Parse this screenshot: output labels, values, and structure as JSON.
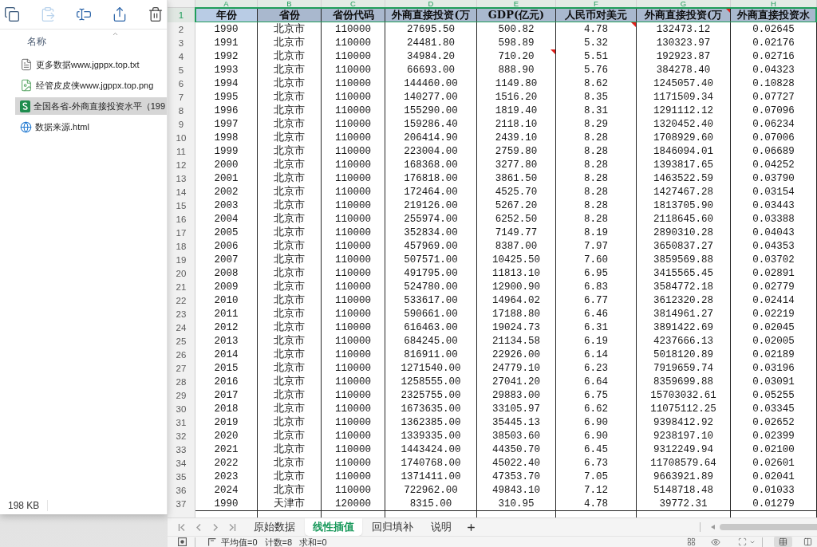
{
  "explorer": {
    "toolbar": [
      {
        "kind": "copy",
        "disabled": false
      },
      {
        "kind": "paste",
        "disabled": true
      },
      {
        "kind": "rename",
        "disabled": false
      },
      {
        "kind": "share",
        "disabled": false
      },
      {
        "kind": "delete",
        "disabled": false
      }
    ],
    "sort_ascending": true,
    "column_header": "名称",
    "files": [
      {
        "name": "更多数据www.jgppx.top.txt",
        "kind": "text",
        "selected": false
      },
      {
        "name": "经管皮皮侠www.jgppx.top.png",
        "kind": "image",
        "selected": false
      },
      {
        "name": "全国各省-外商直接投资水平（199",
        "kind": "spreadsheet",
        "selected": true
      },
      {
        "name": "数据来源.html",
        "kind": "web",
        "selected": false
      }
    ],
    "status": "198 KB"
  },
  "sheet": {
    "columns": [
      {
        "letter": "A",
        "highlighted": true
      },
      {
        "letter": "B",
        "highlighted": true
      },
      {
        "letter": "C",
        "highlighted": true
      },
      {
        "letter": "D",
        "highlighted": true
      },
      {
        "letter": "E",
        "highlighted": true
      },
      {
        "letter": "F",
        "highlighted": true
      },
      {
        "letter": "G",
        "highlighted": true
      },
      {
        "letter": "H",
        "highlighted": true
      }
    ],
    "rows": [
      {
        "kind": "header",
        "number": "1",
        "selected": true,
        "cells": [
          "年份",
          "省份",
          "省份代码",
          "外商直接投资(万",
          "GDP(亿元)",
          "人民币对美元",
          "外商直接投资(万",
          "外商直接投资水"
        ],
        "notes": [
          false,
          false,
          false,
          false,
          false,
          false,
          true,
          false
        ]
      },
      {
        "kind": "data",
        "number": "2",
        "selected": false,
        "cells": [
          "1990",
          "北京市",
          "110000",
          "27695.50",
          "500.82",
          "4.78",
          "132473.12",
          "0.02645"
        ],
        "notes": [
          false,
          false,
          false,
          false,
          false,
          true,
          false,
          false
        ]
      },
      {
        "kind": "data",
        "number": "3",
        "selected": false,
        "cells": [
          "1991",
          "北京市",
          "110000",
          "24481.80",
          "598.89",
          "5.32",
          "130323.97",
          "0.02176"
        ],
        "notes": [
          false,
          false,
          false,
          false,
          false,
          false,
          false,
          false
        ]
      },
      {
        "kind": "data",
        "number": "4",
        "selected": false,
        "cells": [
          "1992",
          "北京市",
          "110000",
          "34984.20",
          "710.20",
          "5.51",
          "192923.87",
          "0.02716"
        ],
        "notes": [
          false,
          false,
          false,
          false,
          true,
          false,
          false,
          false
        ]
      },
      {
        "kind": "data",
        "number": "5",
        "selected": false,
        "cells": [
          "1993",
          "北京市",
          "110000",
          "66693.00",
          "888.90",
          "5.76",
          "384278.40",
          "0.04323"
        ],
        "notes": [
          false,
          false,
          false,
          false,
          false,
          false,
          false,
          false
        ]
      },
      {
        "kind": "data",
        "number": "6",
        "selected": false,
        "cells": [
          "1994",
          "北京市",
          "110000",
          "144460.00",
          "1149.80",
          "8.62",
          "1245057.40",
          "0.10828"
        ],
        "notes": [
          false,
          false,
          false,
          false,
          false,
          false,
          false,
          false
        ]
      },
      {
        "kind": "data",
        "number": "7",
        "selected": false,
        "cells": [
          "1995",
          "北京市",
          "110000",
          "140277.00",
          "1516.20",
          "8.35",
          "1171509.34",
          "0.07727"
        ],
        "notes": [
          false,
          false,
          false,
          false,
          false,
          false,
          false,
          false
        ]
      },
      {
        "kind": "data",
        "number": "8",
        "selected": false,
        "cells": [
          "1996",
          "北京市",
          "110000",
          "155290.00",
          "1819.40",
          "8.31",
          "1291112.12",
          "0.07096"
        ],
        "notes": [
          false,
          false,
          false,
          false,
          false,
          false,
          false,
          false
        ]
      },
      {
        "kind": "data",
        "number": "9",
        "selected": false,
        "cells": [
          "1997",
          "北京市",
          "110000",
          "159286.40",
          "2118.10",
          "8.29",
          "1320452.40",
          "0.06234"
        ],
        "notes": [
          false,
          false,
          false,
          false,
          false,
          false,
          false,
          false
        ]
      },
      {
        "kind": "data",
        "number": "10",
        "selected": false,
        "cells": [
          "1998",
          "北京市",
          "110000",
          "206414.90",
          "2439.10",
          "8.28",
          "1708929.60",
          "0.07006"
        ],
        "notes": [
          false,
          false,
          false,
          false,
          false,
          false,
          false,
          false
        ]
      },
      {
        "kind": "data",
        "number": "11",
        "selected": false,
        "cells": [
          "1999",
          "北京市",
          "110000",
          "223004.00",
          "2759.80",
          "8.28",
          "1846094.01",
          "0.06689"
        ],
        "notes": [
          false,
          false,
          false,
          false,
          false,
          false,
          false,
          false
        ]
      },
      {
        "kind": "data",
        "number": "12",
        "selected": false,
        "cells": [
          "2000",
          "北京市",
          "110000",
          "168368.00",
          "3277.80",
          "8.28",
          "1393817.65",
          "0.04252"
        ],
        "notes": [
          false,
          false,
          false,
          false,
          false,
          false,
          false,
          false
        ]
      },
      {
        "kind": "data",
        "number": "13",
        "selected": false,
        "cells": [
          "2001",
          "北京市",
          "110000",
          "176818.00",
          "3861.50",
          "8.28",
          "1463522.59",
          "0.03790"
        ],
        "notes": [
          false,
          false,
          false,
          false,
          false,
          false,
          false,
          false
        ]
      },
      {
        "kind": "data",
        "number": "14",
        "selected": false,
        "cells": [
          "2002",
          "北京市",
          "110000",
          "172464.00",
          "4525.70",
          "8.28",
          "1427467.28",
          "0.03154"
        ],
        "notes": [
          false,
          false,
          false,
          false,
          false,
          false,
          false,
          false
        ]
      },
      {
        "kind": "data",
        "number": "15",
        "selected": false,
        "cells": [
          "2003",
          "北京市",
          "110000",
          "219126.00",
          "5267.20",
          "8.28",
          "1813705.90",
          "0.03443"
        ],
        "notes": [
          false,
          false,
          false,
          false,
          false,
          false,
          false,
          false
        ]
      },
      {
        "kind": "data",
        "number": "16",
        "selected": false,
        "cells": [
          "2004",
          "北京市",
          "110000",
          "255974.00",
          "6252.50",
          "8.28",
          "2118645.60",
          "0.03388"
        ],
        "notes": [
          false,
          false,
          false,
          false,
          false,
          false,
          false,
          false
        ]
      },
      {
        "kind": "data",
        "number": "17",
        "selected": false,
        "cells": [
          "2005",
          "北京市",
          "110000",
          "352834.00",
          "7149.77",
          "8.19",
          "2890310.28",
          "0.04043"
        ],
        "notes": [
          false,
          false,
          false,
          false,
          false,
          false,
          false,
          false
        ]
      },
      {
        "kind": "data",
        "number": "18",
        "selected": false,
        "cells": [
          "2006",
          "北京市",
          "110000",
          "457969.00",
          "8387.00",
          "7.97",
          "3650837.27",
          "0.04353"
        ],
        "notes": [
          false,
          false,
          false,
          false,
          false,
          false,
          false,
          false
        ]
      },
      {
        "kind": "data",
        "number": "19",
        "selected": false,
        "cells": [
          "2007",
          "北京市",
          "110000",
          "507571.00",
          "10425.50",
          "7.60",
          "3859569.88",
          "0.03702"
        ],
        "notes": [
          false,
          false,
          false,
          false,
          false,
          false,
          false,
          false
        ]
      },
      {
        "kind": "data",
        "number": "20",
        "selected": false,
        "cells": [
          "2008",
          "北京市",
          "110000",
          "491795.00",
          "11813.10",
          "6.95",
          "3415565.45",
          "0.02891"
        ],
        "notes": [
          false,
          false,
          false,
          false,
          false,
          false,
          false,
          false
        ]
      },
      {
        "kind": "data",
        "number": "21",
        "selected": false,
        "cells": [
          "2009",
          "北京市",
          "110000",
          "524780.00",
          "12900.90",
          "6.83",
          "3584772.18",
          "0.02779"
        ],
        "notes": [
          false,
          false,
          false,
          false,
          false,
          false,
          false,
          false
        ]
      },
      {
        "kind": "data",
        "number": "22",
        "selected": false,
        "cells": [
          "2010",
          "北京市",
          "110000",
          "533617.00",
          "14964.02",
          "6.77",
          "3612320.28",
          "0.02414"
        ],
        "notes": [
          false,
          false,
          false,
          false,
          false,
          false,
          false,
          false
        ]
      },
      {
        "kind": "data",
        "number": "23",
        "selected": false,
        "cells": [
          "2011",
          "北京市",
          "110000",
          "590661.00",
          "17188.80",
          "6.46",
          "3814961.27",
          "0.02219"
        ],
        "notes": [
          false,
          false,
          false,
          false,
          false,
          false,
          false,
          false
        ]
      },
      {
        "kind": "data",
        "number": "24",
        "selected": false,
        "cells": [
          "2012",
          "北京市",
          "110000",
          "616463.00",
          "19024.73",
          "6.31",
          "3891422.69",
          "0.02045"
        ],
        "notes": [
          false,
          false,
          false,
          false,
          false,
          false,
          false,
          false
        ]
      },
      {
        "kind": "data",
        "number": "25",
        "selected": false,
        "cells": [
          "2013",
          "北京市",
          "110000",
          "684245.00",
          "21134.58",
          "6.19",
          "4237666.13",
          "0.02005"
        ],
        "notes": [
          false,
          false,
          false,
          false,
          false,
          false,
          false,
          false
        ]
      },
      {
        "kind": "data",
        "number": "26",
        "selected": false,
        "cells": [
          "2014",
          "北京市",
          "110000",
          "816911.00",
          "22926.00",
          "6.14",
          "5018120.89",
          "0.02189"
        ],
        "notes": [
          false,
          false,
          false,
          false,
          false,
          false,
          false,
          false
        ]
      },
      {
        "kind": "data",
        "number": "27",
        "selected": false,
        "cells": [
          "2015",
          "北京市",
          "110000",
          "1271540.00",
          "24779.10",
          "6.23",
          "7919659.74",
          "0.03196"
        ],
        "notes": [
          false,
          false,
          false,
          false,
          false,
          false,
          false,
          false
        ]
      },
      {
        "kind": "data",
        "number": "28",
        "selected": false,
        "cells": [
          "2016",
          "北京市",
          "110000",
          "1258555.00",
          "27041.20",
          "6.64",
          "8359699.88",
          "0.03091"
        ],
        "notes": [
          false,
          false,
          false,
          false,
          false,
          false,
          false,
          false
        ]
      },
      {
        "kind": "data",
        "number": "29",
        "selected": false,
        "cells": [
          "2017",
          "北京市",
          "110000",
          "2325755.00",
          "29883.00",
          "6.75",
          "15703032.61",
          "0.05255"
        ],
        "notes": [
          false,
          false,
          false,
          false,
          false,
          false,
          false,
          false
        ]
      },
      {
        "kind": "data",
        "number": "30",
        "selected": false,
        "cells": [
          "2018",
          "北京市",
          "110000",
          "1673635.00",
          "33105.97",
          "6.62",
          "11075112.25",
          "0.03345"
        ],
        "notes": [
          false,
          false,
          false,
          false,
          false,
          false,
          false,
          false
        ]
      },
      {
        "kind": "data",
        "number": "31",
        "selected": false,
        "cells": [
          "2019",
          "北京市",
          "110000",
          "1362385.00",
          "35445.13",
          "6.90",
          "9398412.92",
          "0.02652"
        ],
        "notes": [
          false,
          false,
          false,
          false,
          false,
          false,
          false,
          false
        ]
      },
      {
        "kind": "data",
        "number": "32",
        "selected": false,
        "cells": [
          "2020",
          "北京市",
          "110000",
          "1339335.00",
          "38503.60",
          "6.90",
          "9238197.10",
          "0.02399"
        ],
        "notes": [
          false,
          false,
          false,
          false,
          false,
          false,
          false,
          false
        ]
      },
      {
        "kind": "data",
        "number": "33",
        "selected": false,
        "cells": [
          "2021",
          "北京市",
          "110000",
          "1443424.00",
          "44350.70",
          "6.45",
          "9312249.94",
          "0.02100"
        ],
        "notes": [
          false,
          false,
          false,
          false,
          false,
          false,
          false,
          false
        ]
      },
      {
        "kind": "data",
        "number": "34",
        "selected": false,
        "cells": [
          "2022",
          "北京市",
          "110000",
          "1740768.00",
          "45022.40",
          "6.73",
          "11708579.64",
          "0.02601"
        ],
        "notes": [
          false,
          false,
          false,
          false,
          false,
          false,
          false,
          false
        ]
      },
      {
        "kind": "data",
        "number": "35",
        "selected": false,
        "cells": [
          "2023",
          "北京市",
          "110000",
          "1371411.00",
          "47353.70",
          "7.05",
          "9663921.89",
          "0.02041"
        ],
        "notes": [
          false,
          false,
          false,
          false,
          false,
          false,
          false,
          false
        ]
      },
      {
        "kind": "data",
        "number": "36",
        "selected": false,
        "cells": [
          "2024",
          "北京市",
          "110000",
          "722962.00",
          "49843.10",
          "7.12",
          "5148718.48",
          "0.01033"
        ],
        "notes": [
          false,
          false,
          false,
          false,
          false,
          false,
          false,
          false
        ]
      },
      {
        "kind": "data",
        "number": "37",
        "selected": false,
        "cells": [
          "1990",
          "天津市",
          "120000",
          "8315.00",
          "310.95",
          "4.78",
          "39772.31",
          "0.01279"
        ],
        "notes": [
          false,
          false,
          false,
          false,
          false,
          false,
          false,
          false
        ]
      }
    ]
  },
  "sheet_tabs": [
    {
      "label": "原始数据",
      "selected": false
    },
    {
      "label": "线性插值",
      "selected": true
    },
    {
      "label": "回归填补",
      "selected": false
    },
    {
      "label": "说明",
      "selected": false
    }
  ],
  "status_bar": {
    "stats": [
      "平均值=0",
      "计数=8",
      "求和=0"
    ],
    "views": [
      {
        "kind": "normal",
        "selected": true
      },
      {
        "kind": "page",
        "selected": false
      }
    ]
  }
}
